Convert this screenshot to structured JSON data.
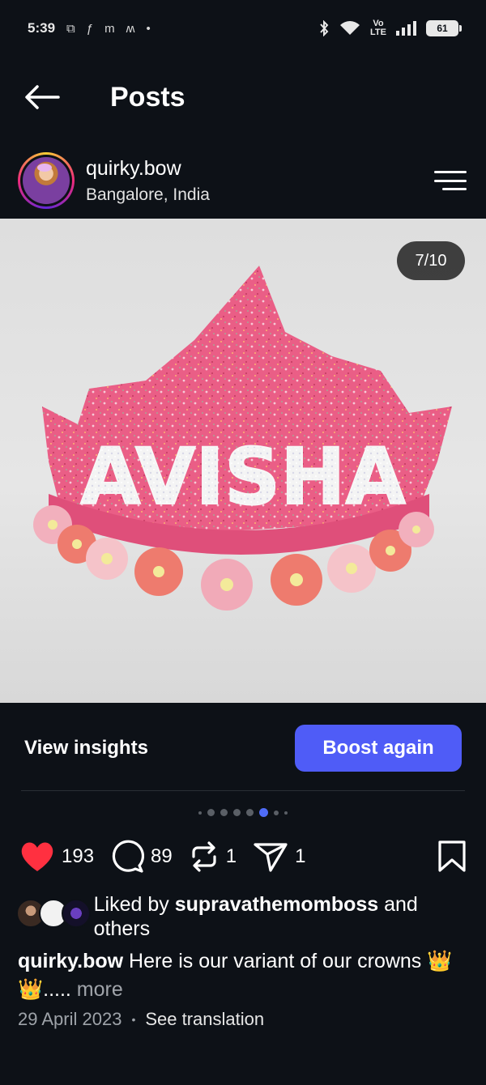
{
  "status_bar": {
    "time": "5:39",
    "left_icons": [
      "screen-icon",
      "facebook-icon",
      "m-icon",
      "m-icon",
      "dot-icon"
    ],
    "right_icons": [
      "bluetooth-icon",
      "wifi-icon",
      "volte-icon",
      "signal-icon",
      "battery-icon"
    ],
    "volte_label": "Vo\nLTE",
    "battery_level": "61"
  },
  "header": {
    "title": "Posts",
    "back_icon": "arrow-left-icon"
  },
  "profile": {
    "username": "quirky.bow",
    "location": "Bangalore, India",
    "menu_icon": "hamburger-icon"
  },
  "post": {
    "image_counter": "7/10",
    "image_text": "AVISHA",
    "carousel_total_dots": 8,
    "carousel_active_index": 5
  },
  "insights": {
    "view_insights_label": "View insights",
    "boost_label": "Boost again",
    "boost_color": "#4f5cf7"
  },
  "actions": {
    "likes_count": "193",
    "comments_count": "89",
    "reposts_count": "1",
    "shares_count": "1",
    "like_color": "#ff3040"
  },
  "likes_line": {
    "prefix": "Liked by ",
    "user": "supravathemomboss",
    "suffix": " and others"
  },
  "caption": {
    "username": "quirky.bow",
    "text": " Here is our variant of our crowns 👑👑.....",
    "more_label": " more"
  },
  "meta": {
    "date": "29 April 2023",
    "translate_label": "See translation"
  }
}
